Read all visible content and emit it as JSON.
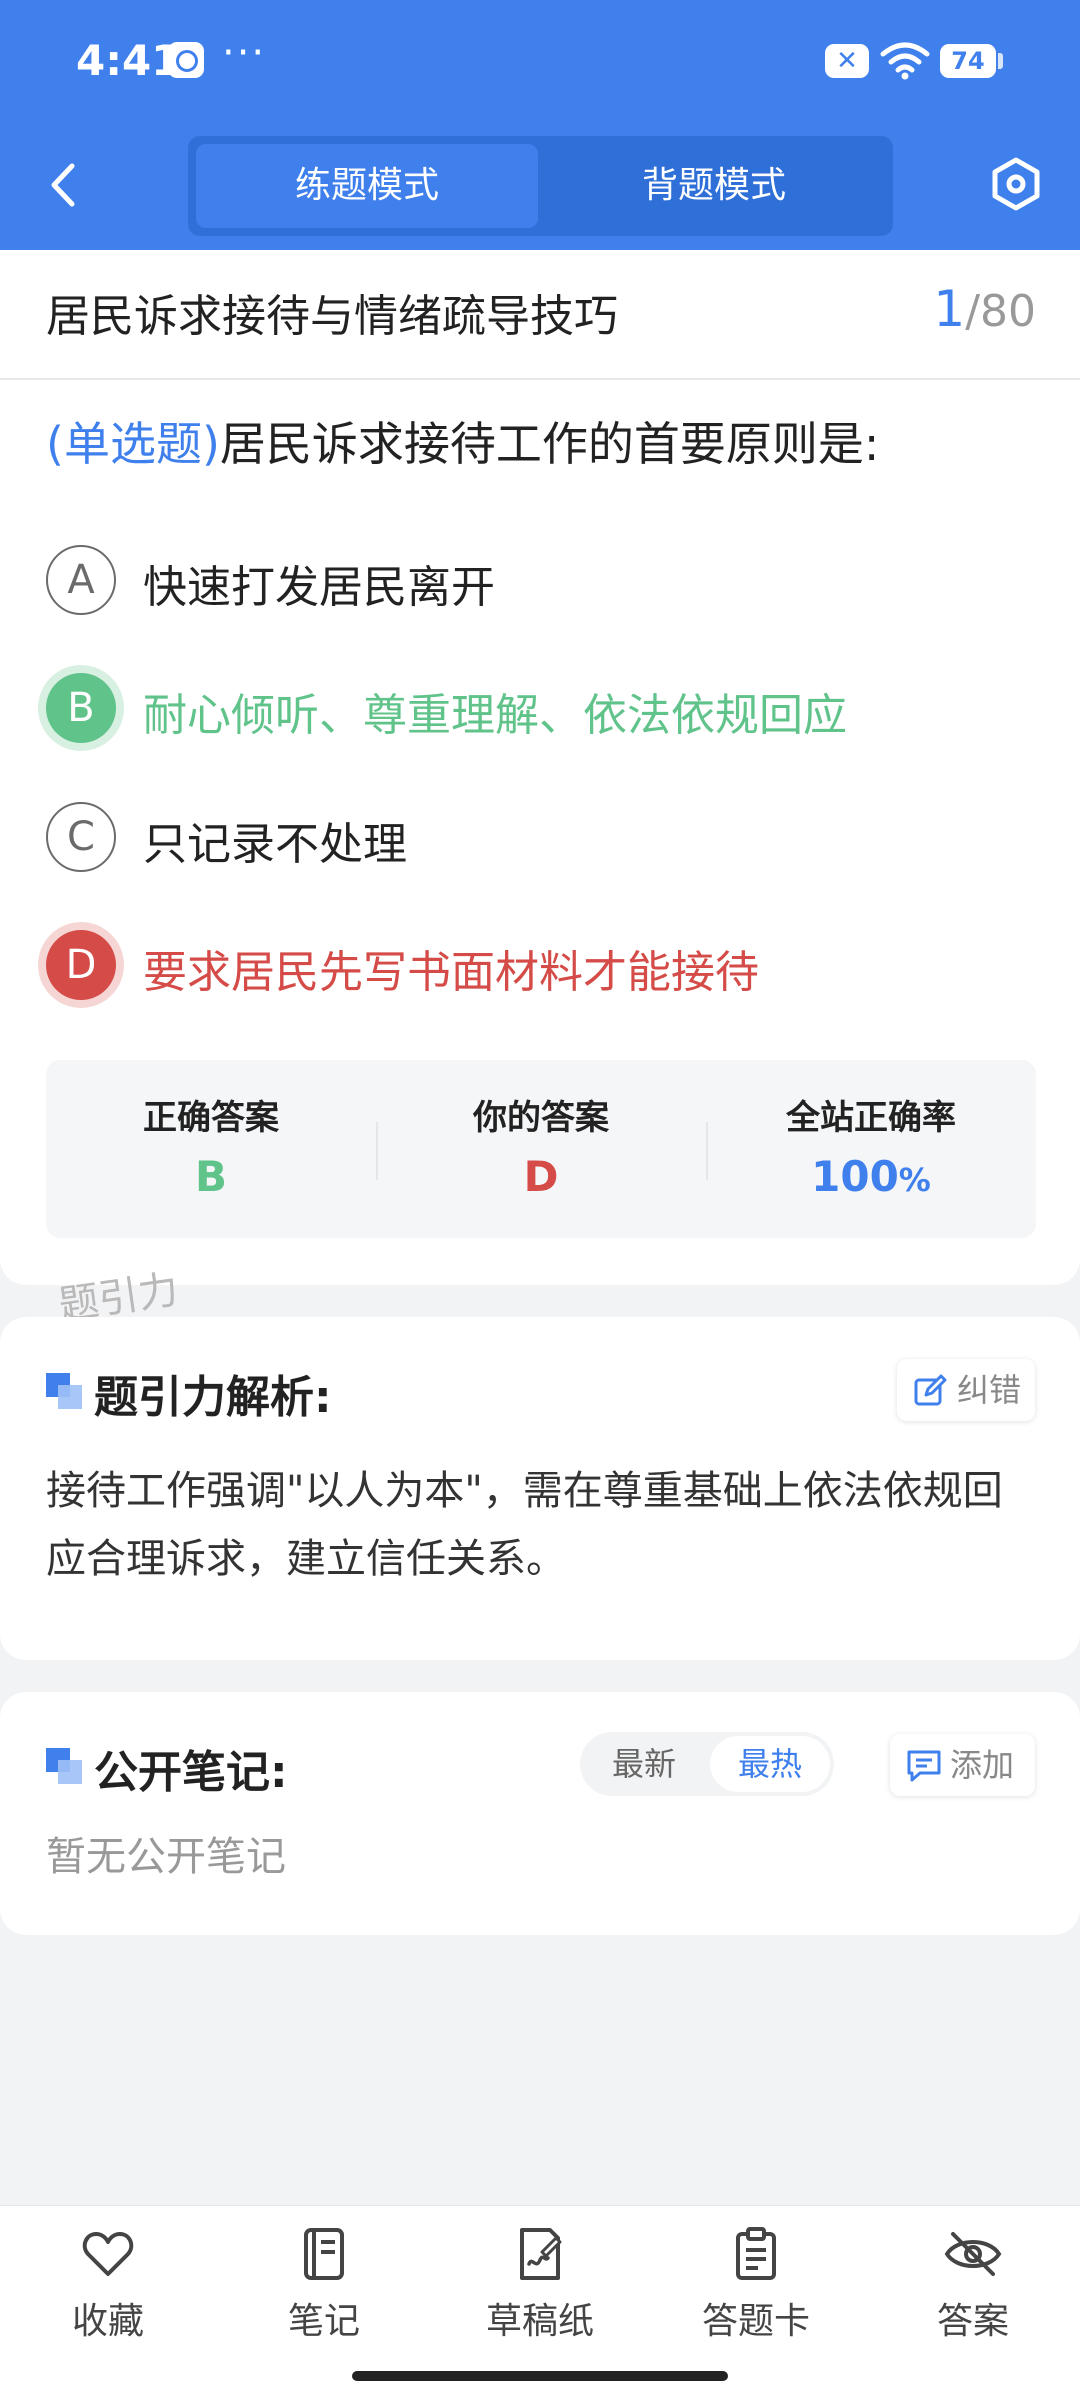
{
  "status_bar": {
    "time": "4:41",
    "dots": "···",
    "x_badge": "✕",
    "battery": "74"
  },
  "header": {
    "modes": [
      "练题模式",
      "背题模式"
    ],
    "active_mode": "练题模式"
  },
  "question": {
    "section_title": "居民诉求接待与情绪疏导技巧",
    "current": "1",
    "total": "/80",
    "type_label": "(单选题)",
    "text": "居民诉求接待工作的首要原则是:",
    "options": [
      {
        "letter": "A",
        "text": "快速打发居民离开",
        "state": "normal"
      },
      {
        "letter": "B",
        "text": "耐心倾听、尊重理解、依法依规回应",
        "state": "correct"
      },
      {
        "letter": "C",
        "text": "只记录不处理",
        "state": "normal"
      },
      {
        "letter": "D",
        "text": "要求居民先写书面材料才能接待",
        "state": "wrong"
      }
    ]
  },
  "answer_summary": {
    "correct_label": "正确答案",
    "correct_value": "B",
    "yours_label": "你的答案",
    "yours_value": "D",
    "rate_label": "全站正确率",
    "rate_value": "100",
    "rate_unit": "%"
  },
  "watermark": "题引力",
  "analysis": {
    "title": "题引力解析:",
    "report_button": "纠错",
    "text": "接待工作强调\"以人为本\"，需在尊重基础上依法依规回应合理诉求，建立信任关系。"
  },
  "notes": {
    "title": "公开笔记:",
    "sort_newest": "最新",
    "sort_hottest": "最热",
    "add_button": "添加",
    "empty": "暂无公开笔记"
  },
  "bottom_nav": {
    "favorite": "收藏",
    "notes": "笔记",
    "scratch": "草稿纸",
    "answer_card": "答题卡",
    "answer": "答案"
  },
  "colors": {
    "primary": "#3f80ed",
    "correct": "#5fc38a",
    "wrong": "#d44b47"
  }
}
